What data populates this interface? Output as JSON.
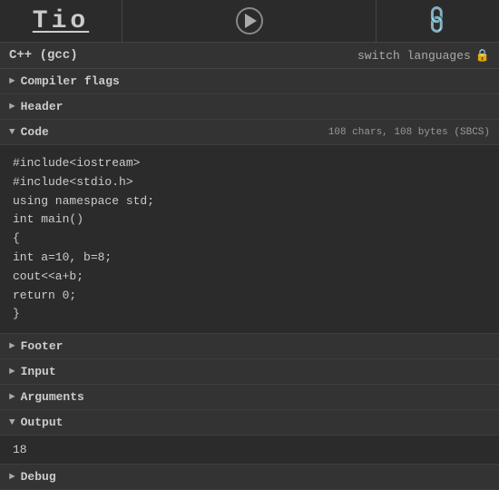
{
  "topbar": {
    "logo": "Tio",
    "play_icon": "play",
    "link_icon": "🔗"
  },
  "lang_bar": {
    "language": "C++ (gcc)",
    "switch_languages_label": "switch languages",
    "lock_symbol": "🔒"
  },
  "sections": {
    "compiler_flags": {
      "label": "Compiler flags",
      "collapsed": true,
      "arrow_collapsed": "►"
    },
    "header": {
      "label": "Header",
      "collapsed": true,
      "arrow_collapsed": "►"
    },
    "code": {
      "label": "Code",
      "collapsed": false,
      "arrow_expanded": "▼",
      "meta": "108 chars, 108 bytes (SBCS)",
      "content": "#include<iostream>\n#include<stdio.h>\nusing namespace std;\nint main()\n{\nint a=10, b=8;\ncout<<a+b;\nreturn 0;\n}"
    },
    "footer": {
      "label": "Footer",
      "collapsed": true,
      "arrow_collapsed": "►"
    },
    "input": {
      "label": "Input",
      "collapsed": true,
      "arrow_collapsed": "►"
    },
    "arguments": {
      "label": "Arguments",
      "collapsed": true,
      "arrow_collapsed": "►"
    },
    "output": {
      "label": "Output",
      "collapsed": false,
      "arrow_expanded": "▼",
      "content": "18"
    },
    "debug": {
      "label": "Debug",
      "collapsed": true,
      "arrow_collapsed": "►"
    }
  }
}
